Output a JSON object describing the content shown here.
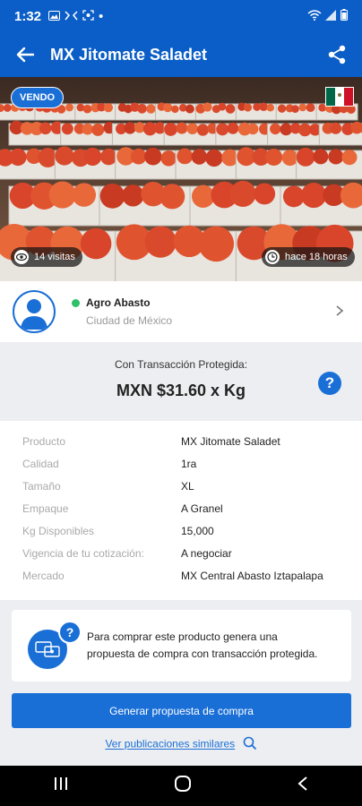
{
  "status_bar": {
    "time": "1:32"
  },
  "app_bar": {
    "title": "MX Jitomate Saladet"
  },
  "hero": {
    "badge": "VENDO",
    "flag_colors": [
      "#006847",
      "#ffffff",
      "#ce1126"
    ],
    "views": "14 visitas",
    "posted": "hace 18 horas"
  },
  "seller": {
    "name": "Agro Abasto",
    "city": "Ciudad de México",
    "online_color": "#2fc06a"
  },
  "price": {
    "label": "Con Transacción Protegida:",
    "value": "MXN $31.60 x Kg"
  },
  "details": [
    {
      "key": "Producto",
      "value": "MX Jitomate Saladet"
    },
    {
      "key": "Calidad",
      "value": "1ra"
    },
    {
      "key": "Tamaño",
      "value": "XL"
    },
    {
      "key": "Empaque",
      "value": "A Granel"
    },
    {
      "key": "Kg Disponibles",
      "value": "15,000"
    },
    {
      "key": "Vigencia de tu cotización:",
      "value": "A negociar"
    },
    {
      "key": "Mercado",
      "value": "MX Central Abasto Iztapalapa"
    }
  ],
  "info": {
    "line1": "Para comprar este producto genera una",
    "line2": "propuesta de compra con transacción protegida."
  },
  "cta": {
    "label": "Generar propuesta de compra"
  },
  "similar": {
    "label": "Ver publicaciones similares"
  },
  "colors": {
    "primary": "#0b5ec7",
    "accent": "#1a6fd6"
  }
}
